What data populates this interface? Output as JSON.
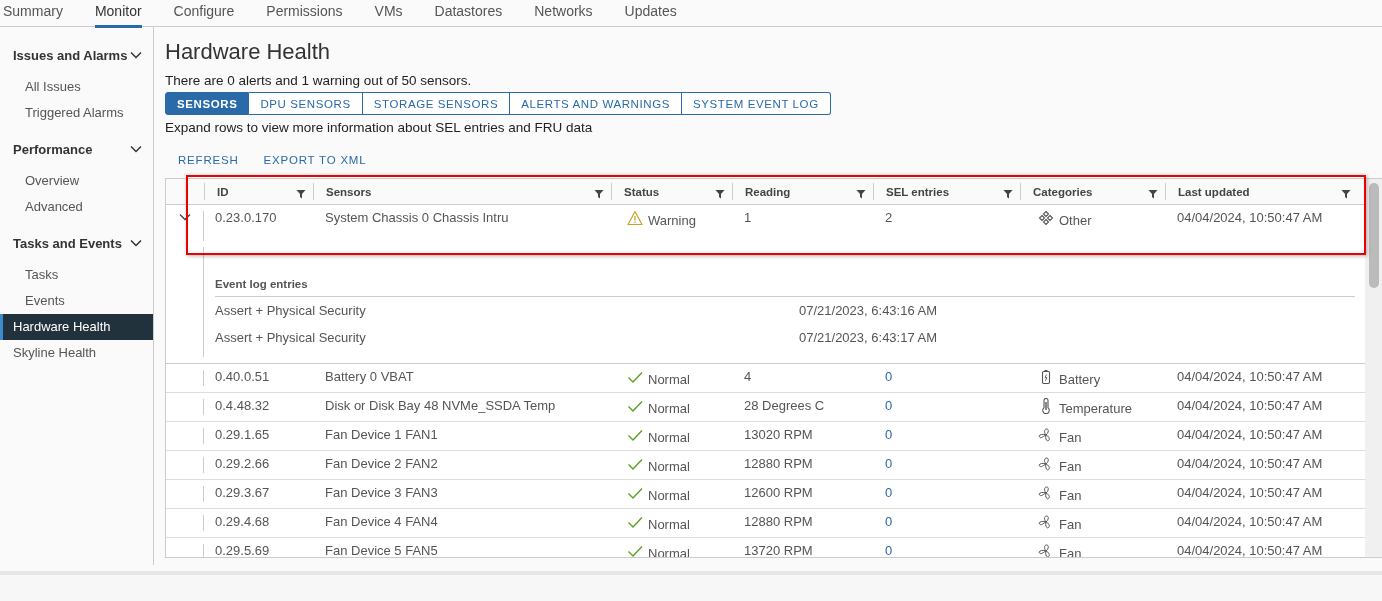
{
  "top_tabs": [
    {
      "label": "Summary",
      "selected": false
    },
    {
      "label": "Monitor",
      "selected": true
    },
    {
      "label": "Configure",
      "selected": false
    },
    {
      "label": "Permissions",
      "selected": false
    },
    {
      "label": "VMs",
      "selected": false
    },
    {
      "label": "Datastores",
      "selected": false
    },
    {
      "label": "Networks",
      "selected": false
    },
    {
      "label": "Updates",
      "selected": false
    }
  ],
  "sidebar": {
    "groups": [
      {
        "label": "Issues and Alarms",
        "expanded": true,
        "items": [
          {
            "label": "All Issues",
            "selected": false
          },
          {
            "label": "Triggered Alarms",
            "selected": false
          }
        ]
      },
      {
        "label": "Performance",
        "expanded": true,
        "items": [
          {
            "label": "Overview",
            "selected": false
          },
          {
            "label": "Advanced",
            "selected": false
          }
        ]
      },
      {
        "label": "Tasks and Events",
        "expanded": true,
        "items": [
          {
            "label": "Tasks",
            "selected": false
          },
          {
            "label": "Events",
            "selected": false
          }
        ]
      }
    ],
    "items": [
      {
        "label": "Hardware Health",
        "selected": true
      },
      {
        "label": "Skyline Health",
        "selected": false
      }
    ]
  },
  "page": {
    "title": "Hardware Health",
    "summary": "There are 0 alerts and 1 warning out of 50 sensors.",
    "tabs": [
      {
        "label": "SENSORS",
        "selected": true
      },
      {
        "label": "DPU SENSORS",
        "selected": false
      },
      {
        "label": "STORAGE SENSORS",
        "selected": false
      },
      {
        "label": "ALERTS AND WARNINGS",
        "selected": false
      },
      {
        "label": "SYSTEM EVENT LOG",
        "selected": false
      }
    ],
    "hint": "Expand rows to view more information about SEL entries and FRU data",
    "actions": [
      "REFRESH",
      "EXPORT TO XML"
    ]
  },
  "table": {
    "columns": [
      "ID",
      "Sensors",
      "Status",
      "Reading",
      "SEL entries",
      "Categories",
      "Last updated"
    ],
    "rows": [
      {
        "expanded": true,
        "id": "0.23.0.170",
        "sensor": "System Chassis 0 Chassis Intru",
        "status": {
          "kind": "warning",
          "label": "Warning"
        },
        "reading": "1",
        "sel_entries": "2",
        "sel_link": false,
        "category": {
          "kind": "other",
          "label": "Other"
        },
        "last_updated": "04/04/2024, 10:50:47 AM",
        "detail": {
          "title": "Event log entries",
          "entries": [
            {
              "event": "Assert + Physical Security",
              "time": "07/21/2023, 6:43:16 AM"
            },
            {
              "event": "Assert + Physical Security",
              "time": "07/21/2023, 6:43:17 AM"
            }
          ]
        }
      },
      {
        "expanded": false,
        "id": "0.40.0.51",
        "sensor": "Battery 0 VBAT",
        "status": {
          "kind": "normal",
          "label": "Normal"
        },
        "reading": "4",
        "sel_entries": "0",
        "sel_link": true,
        "category": {
          "kind": "battery",
          "label": "Battery"
        },
        "last_updated": "04/04/2024, 10:50:47 AM"
      },
      {
        "expanded": false,
        "id": "0.4.48.32",
        "sensor": "Disk or Disk Bay 48 NVMe_SSDA Temp",
        "status": {
          "kind": "normal",
          "label": "Normal"
        },
        "reading": "28 Degrees C",
        "sel_entries": "0",
        "sel_link": true,
        "category": {
          "kind": "temperature",
          "label": "Temperature"
        },
        "last_updated": "04/04/2024, 10:50:47 AM"
      },
      {
        "expanded": false,
        "id": "0.29.1.65",
        "sensor": "Fan Device 1 FAN1",
        "status": {
          "kind": "normal",
          "label": "Normal"
        },
        "reading": "13020 RPM",
        "sel_entries": "0",
        "sel_link": true,
        "category": {
          "kind": "fan",
          "label": "Fan"
        },
        "last_updated": "04/04/2024, 10:50:47 AM"
      },
      {
        "expanded": false,
        "id": "0.29.2.66",
        "sensor": "Fan Device 2 FAN2",
        "status": {
          "kind": "normal",
          "label": "Normal"
        },
        "reading": "12880 RPM",
        "sel_entries": "0",
        "sel_link": true,
        "category": {
          "kind": "fan",
          "label": "Fan"
        },
        "last_updated": "04/04/2024, 10:50:47 AM"
      },
      {
        "expanded": false,
        "id": "0.29.3.67",
        "sensor": "Fan Device 3 FAN3",
        "status": {
          "kind": "normal",
          "label": "Normal"
        },
        "reading": "12600 RPM",
        "sel_entries": "0",
        "sel_link": true,
        "category": {
          "kind": "fan",
          "label": "Fan"
        },
        "last_updated": "04/04/2024, 10:50:47 AM"
      },
      {
        "expanded": false,
        "id": "0.29.4.68",
        "sensor": "Fan Device 4 FAN4",
        "status": {
          "kind": "normal",
          "label": "Normal"
        },
        "reading": "12880 RPM",
        "sel_entries": "0",
        "sel_link": true,
        "category": {
          "kind": "fan",
          "label": "Fan"
        },
        "last_updated": "04/04/2024, 10:50:47 AM"
      },
      {
        "expanded": false,
        "id": "0.29.5.69",
        "sensor": "Fan Device 5 FAN5",
        "status": {
          "kind": "normal",
          "label": "Normal"
        },
        "reading": "13720 RPM",
        "sel_entries": "0",
        "sel_link": true,
        "category": {
          "kind": "fan",
          "label": "Fan"
        },
        "last_updated": "04/04/2024, 10:50:47 AM"
      }
    ]
  }
}
